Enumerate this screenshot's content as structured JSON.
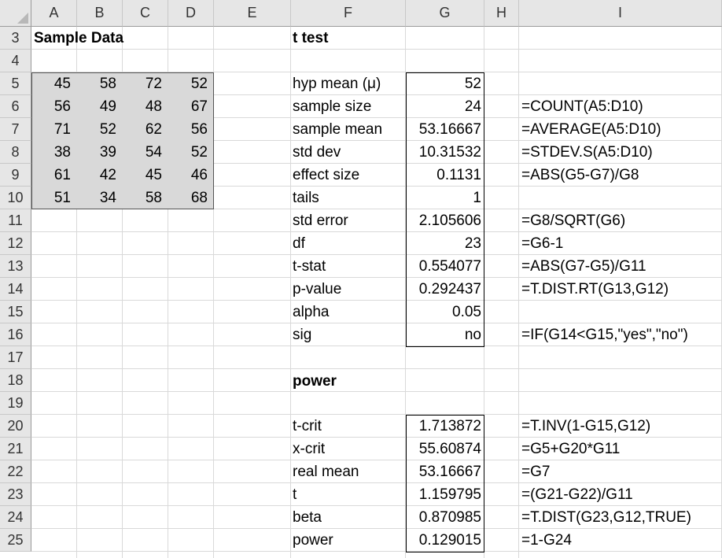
{
  "columns": [
    "A",
    "B",
    "C",
    "D",
    "E",
    "F",
    "G",
    "H",
    "I"
  ],
  "rows": [
    "3",
    "4",
    "5",
    "6",
    "7",
    "8",
    "9",
    "10",
    "11",
    "12",
    "13",
    "14",
    "15",
    "16",
    "17",
    "18",
    "19",
    "20",
    "21",
    "22",
    "23",
    "24",
    "25"
  ],
  "sample_title": "Sample Data",
  "sample_data": [
    [
      "45",
      "58",
      "72",
      "52"
    ],
    [
      "56",
      "49",
      "48",
      "67"
    ],
    [
      "71",
      "52",
      "62",
      "56"
    ],
    [
      "38",
      "39",
      "54",
      "52"
    ],
    [
      "61",
      "42",
      "45",
      "46"
    ],
    [
      "51",
      "34",
      "58",
      "68"
    ]
  ],
  "ttest": {
    "title": "t test",
    "rows": [
      {
        "label": "hyp mean (μ)",
        "value": "52",
        "formula": ""
      },
      {
        "label": "sample size",
        "value": "24",
        "formula": "=COUNT(A5:D10)"
      },
      {
        "label": "sample mean",
        "value": "53.16667",
        "formula": "=AVERAGE(A5:D10)"
      },
      {
        "label": "std dev",
        "value": "10.31532",
        "formula": "=STDEV.S(A5:D10)"
      },
      {
        "label": "effect size",
        "value": "0.1131",
        "formula": "=ABS(G5-G7)/G8"
      },
      {
        "label": "tails",
        "value": "1",
        "formula": ""
      },
      {
        "label": "std error",
        "value": "2.105606",
        "formula": "=G8/SQRT(G6)"
      },
      {
        "label": "df",
        "value": "23",
        "formula": "=G6-1"
      },
      {
        "label": "t-stat",
        "value": "0.554077",
        "formula": "=ABS(G7-G5)/G11"
      },
      {
        "label": "p-value",
        "value": "0.292437",
        "formula": "=T.DIST.RT(G13,G12)"
      },
      {
        "label": "alpha",
        "value": "0.05",
        "formula": ""
      },
      {
        "label": "sig",
        "value": "no",
        "formula": "=IF(G14<G15,\"yes\",\"no\")"
      }
    ]
  },
  "power": {
    "title": "power",
    "rows": [
      {
        "label": "t-crit",
        "value": "1.713872",
        "formula": "=T.INV(1-G15,G12)"
      },
      {
        "label": "x-crit",
        "value": "55.60874",
        "formula": "=G5+G20*G11"
      },
      {
        "label": "real mean",
        "value": "53.16667",
        "formula": "=G7"
      },
      {
        "label": "t",
        "value": "1.159795",
        "formula": "=(G21-G22)/G11"
      },
      {
        "label": "beta",
        "value": "0.870985",
        "formula": "=T.DIST(G23,G12,TRUE)"
      },
      {
        "label": "power",
        "value": "0.129015",
        "formula": "=1-G24"
      }
    ]
  }
}
